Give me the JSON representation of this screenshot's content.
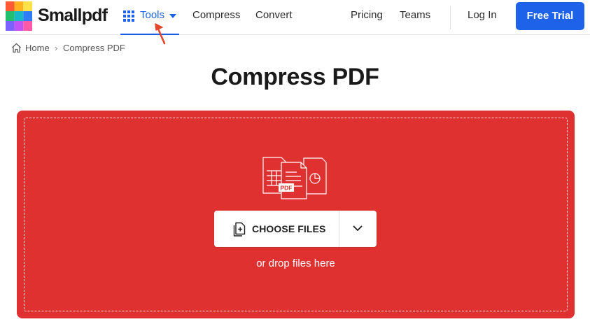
{
  "header": {
    "brand": "Smallpdf",
    "nav": {
      "tools": "Tools",
      "compress": "Compress",
      "convert": "Convert",
      "pricing": "Pricing",
      "teams": "Teams",
      "login": "Log In",
      "free_trial": "Free Trial"
    }
  },
  "breadcrumb": {
    "home": "Home",
    "separator": "›",
    "current": "Compress PDF"
  },
  "page": {
    "title": "Compress PDF"
  },
  "dropzone": {
    "illustration_badge": "PDF",
    "choose_files": "CHOOSE FILES",
    "hint": "or drop files here"
  },
  "colors": {
    "accent": "#1e62e9",
    "dropzone": "#e03131",
    "cursor": "#e0472c"
  },
  "icons": [
    "logo-icon",
    "grid-icon",
    "caret-down-icon",
    "home-icon",
    "files-illustration",
    "file-plus-icon",
    "chevron-down-icon",
    "cursor-arrow-icon"
  ]
}
